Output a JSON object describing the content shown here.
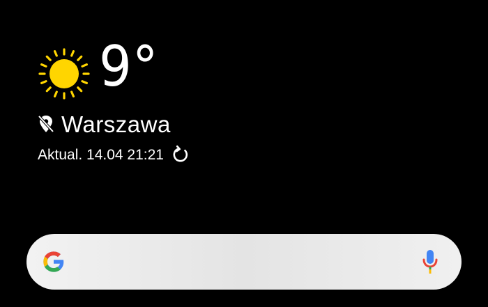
{
  "weather": {
    "temperature": "9°",
    "condition_icon": "sun-icon",
    "location": "Warszawa",
    "updated": "Aktual. 14.04 21:21"
  },
  "search": {
    "provider_icon": "google-logo",
    "voice_icon": "mic-icon"
  },
  "colors": {
    "background": "#000000",
    "text": "#ffffff",
    "sun": "#FFD500",
    "search_bar": "#e8e8e8",
    "google_blue": "#4285F4",
    "google_red": "#EA4335",
    "google_yellow": "#FBBC05",
    "google_green": "#34A853"
  }
}
